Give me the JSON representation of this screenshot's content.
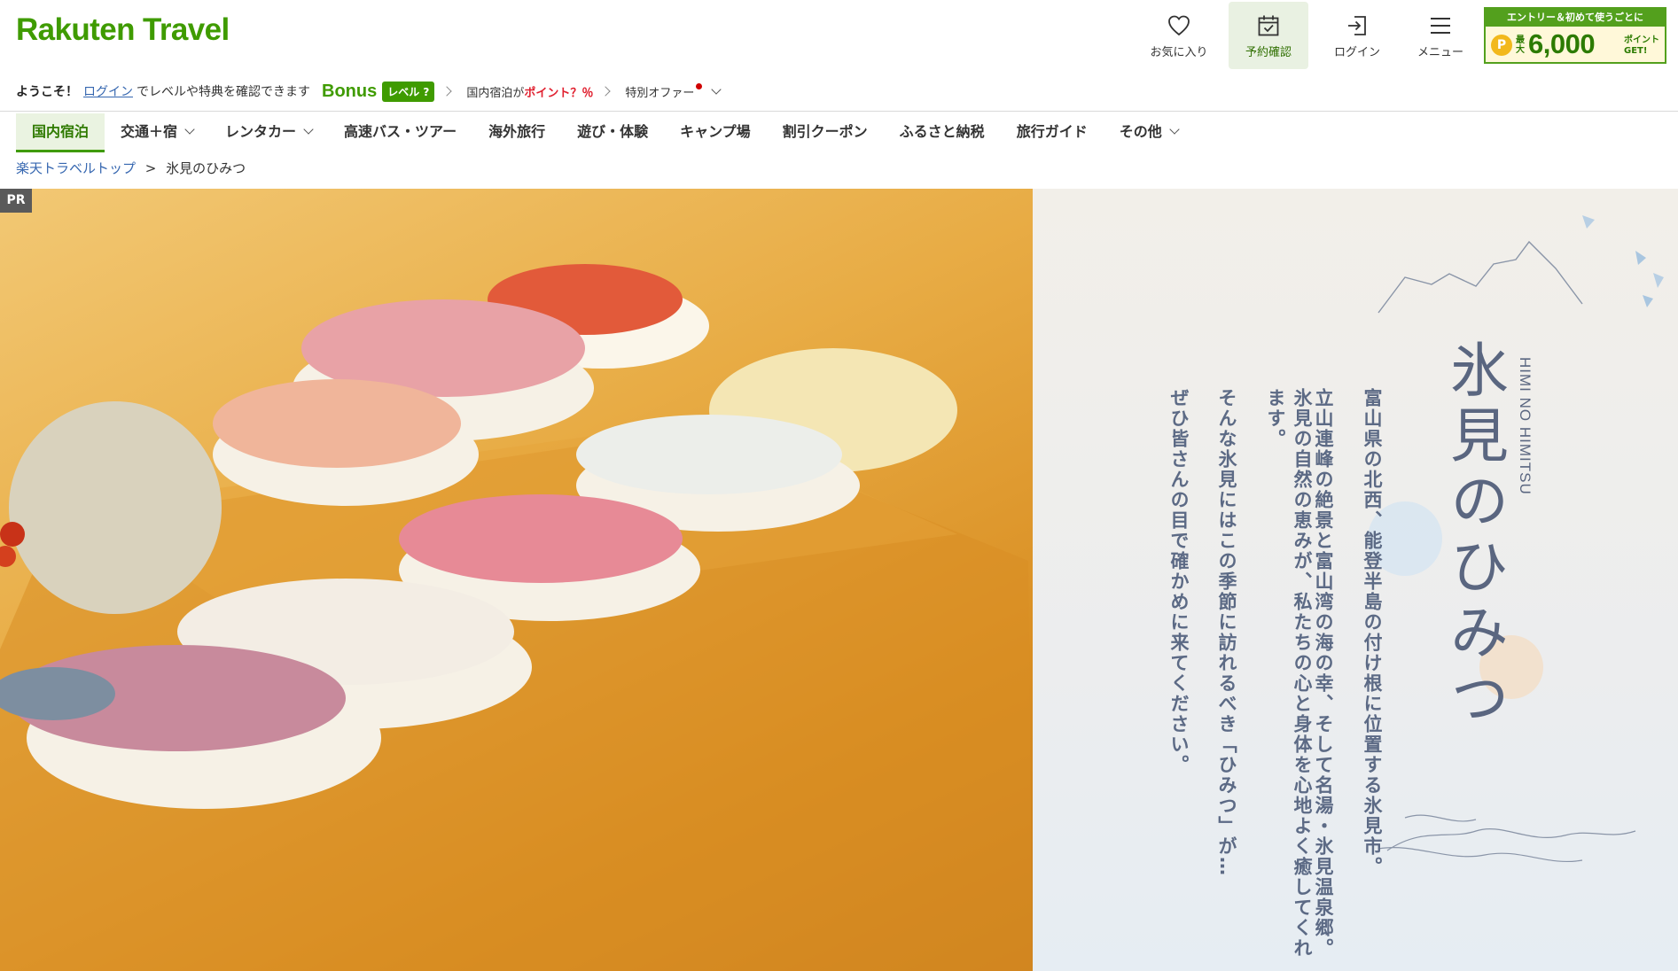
{
  "header": {
    "logo": "Rakuten Travel",
    "utility": [
      {
        "id": "favorites",
        "label": "お気に入り",
        "icon": "heart-icon"
      },
      {
        "id": "reservations",
        "label": "予約確認",
        "icon": "calendar-check-icon"
      },
      {
        "id": "login",
        "label": "ログイン",
        "icon": "login-icon"
      },
      {
        "id": "menu",
        "label": "メニュー",
        "icon": "hamburger-menu-icon"
      }
    ],
    "promo": {
      "top": "エントリー＆初めて使うごとに",
      "prefix": "最大",
      "amount": "6,000",
      "unit": "ポイントGET!"
    }
  },
  "welcome": {
    "greeting": "ようこそ！",
    "login_link": "ログイン",
    "suffix": "でレベルや特典を確認できます",
    "bonus": "Bonus",
    "level_badge": "レベル ?",
    "points_prefix": "国内宿泊が",
    "points_highlight": "ポイント？％",
    "offer": "特別オファー"
  },
  "nav": {
    "items": [
      {
        "label": "国内宿泊",
        "active": true
      },
      {
        "label": "交通＋宿",
        "dropdown": true
      },
      {
        "label": "レンタカー",
        "dropdown": true
      },
      {
        "label": "高速バス・ツアー"
      },
      {
        "label": "海外旅行"
      },
      {
        "label": "遊び・体験"
      },
      {
        "label": "キャンプ場"
      },
      {
        "label": "割引クーポン"
      },
      {
        "label": "ふるさと納税"
      },
      {
        "label": "旅行ガイド"
      },
      {
        "label": "その他",
        "dropdown": true
      }
    ]
  },
  "breadcrumb": {
    "home": "楽天トラベルトップ",
    "separator": ">",
    "current": "氷見のひみつ"
  },
  "hero": {
    "pr": "PR",
    "subtitle_en": "HIMI NO HIMITSU",
    "title": "氷見のひみつ",
    "lines": [
      "富山県の北西、能登半島の付け根に位置する氷見市。",
      "立山連峰の絶景と富山湾の海の幸、そして名湯・氷見温泉郷。",
      "氷見の自然の恵みが、私たちの心と身体を心地よく癒してくれます。",
      "そんな氷見にはこの季節に訪れるべき「ひみつ」が…",
      "ぜひ皆さんの目で確かめに来てください。"
    ],
    "image_subject": "sushi-platter-photo"
  },
  "colors": {
    "brand_green": "#3f9b00",
    "link_blue": "#3667b0",
    "accent_red": "#e0202f",
    "hero_text": "#5a6680"
  }
}
